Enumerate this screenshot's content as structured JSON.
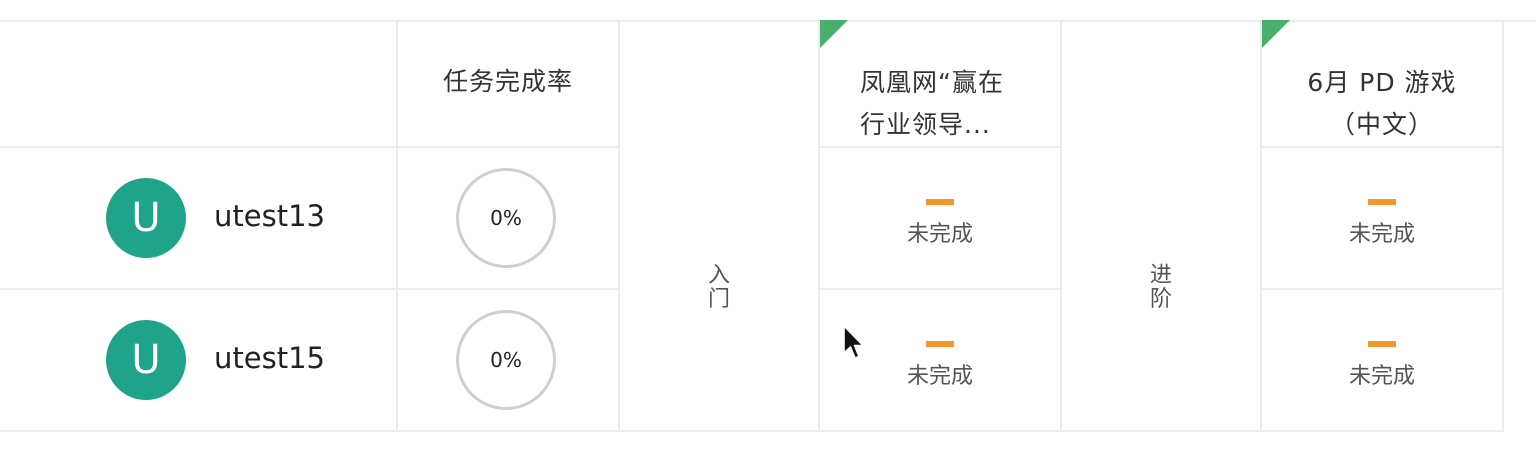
{
  "header": {
    "completion_rate_label": "任务完成率",
    "tasks": [
      {
        "title_line1": "凤凰网“赢在",
        "title_line2": "行业领导..."
      },
      {
        "title_line1": "6月 PD 游戏",
        "title_line2": "（中文）"
      }
    ]
  },
  "levels": [
    {
      "chars": [
        "入",
        "门"
      ]
    },
    {
      "chars": [
        "进",
        "阶"
      ]
    }
  ],
  "rows": [
    {
      "avatar_letter": "U",
      "username": "utest13",
      "completion_rate": "0%",
      "task_statuses": [
        "未完成",
        "未完成"
      ]
    },
    {
      "avatar_letter": "U",
      "username": "utest15",
      "completion_rate": "0%",
      "task_statuses": [
        "未完成",
        "未完成"
      ]
    }
  ],
  "colors": {
    "avatar": "#1fa489",
    "task_marker": "#4cae6c",
    "incomplete_dash": "#f5962a",
    "grid_line": "#ececec"
  },
  "icons": {
    "task_marker": "green-corner-triangle",
    "incomplete": "orange-dash",
    "cursor": "mouse-pointer-icon"
  }
}
